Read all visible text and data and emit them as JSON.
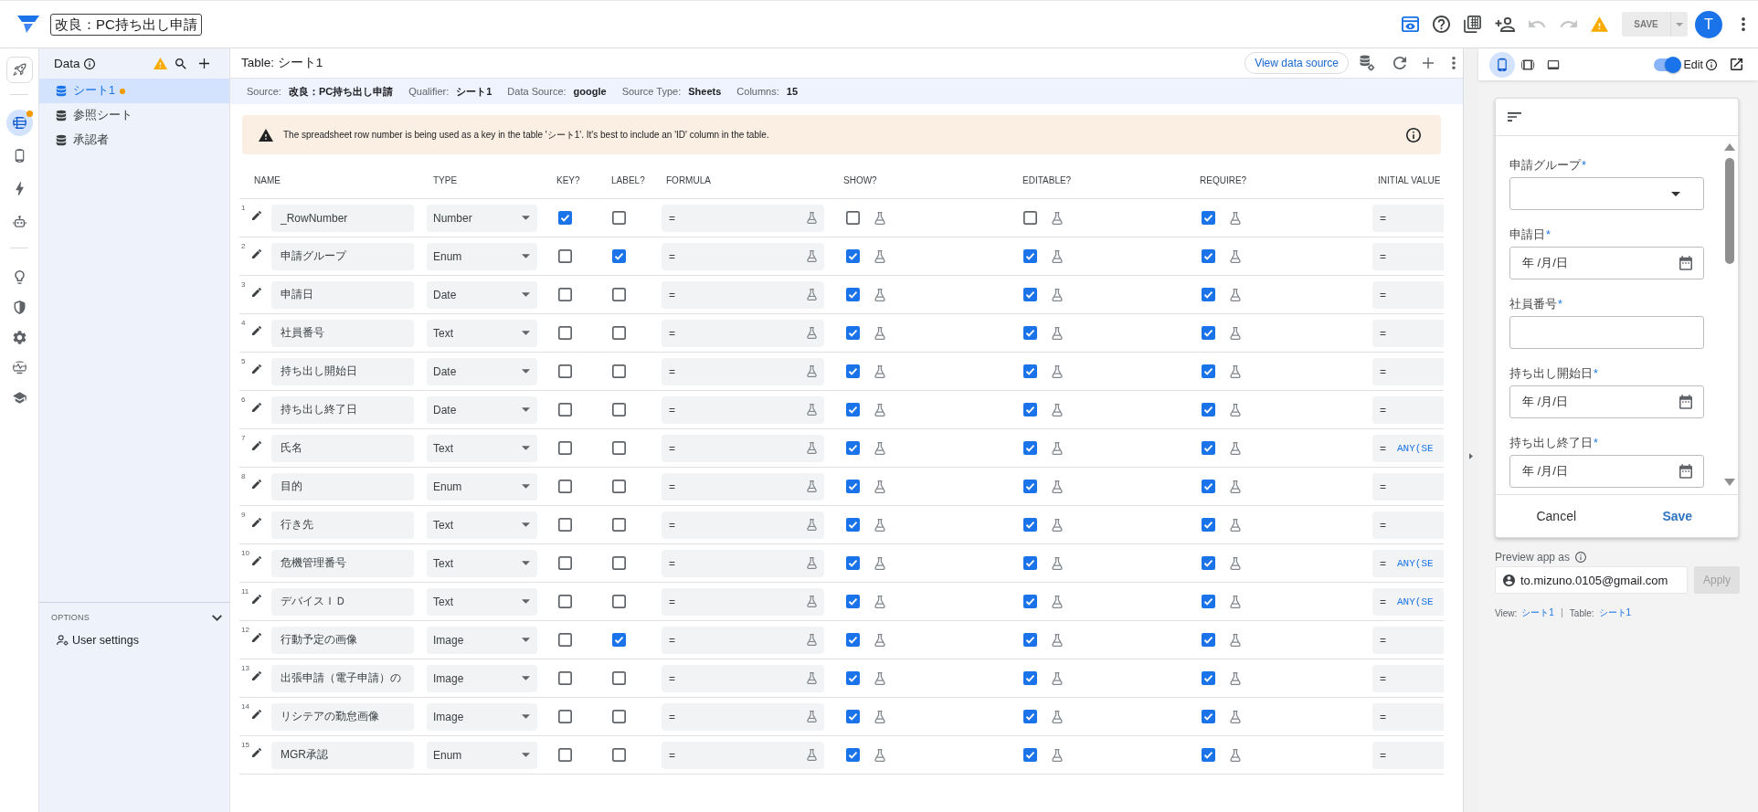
{
  "app_bar": {
    "title": "改良：PC持ち出し申請",
    "actions": [
      {
        "selected": true,
        "disabled": false
      },
      {
        "selected": false,
        "disabled": false
      },
      {
        "selected": false,
        "disabled": false
      },
      {
        "selected": false,
        "disabled": false
      },
      {
        "selected": false,
        "disabled": true
      },
      {
        "selected": false,
        "disabled": true
      },
      {
        "selected": false,
        "disabled": false
      }
    ],
    "save": {
      "label": "SAVE",
      "disabled": true
    },
    "avatar": "T"
  },
  "nav_rail": [
    [
      {
        "selected": false,
        "badge": false
      }
    ],
    [
      {
        "selected": true,
        "badge": true
      },
      {
        "selected": false,
        "badge": false
      },
      {
        "selected": false,
        "badge": false
      },
      {
        "selected": false,
        "badge": false
      }
    ],
    [
      {
        "selected": false,
        "badge": false
      },
      {
        "selected": false,
        "badge": false
      },
      {
        "selected": false,
        "badge": false
      },
      {
        "selected": false,
        "badge": false
      },
      {
        "selected": false,
        "badge": false
      }
    ]
  ],
  "data_panel": {
    "title": "Data",
    "tables": [
      {
        "name": "シート1",
        "selected": true,
        "modified": true
      },
      {
        "name": "参照シート",
        "selected": false,
        "modified": false
      },
      {
        "name": "承認者",
        "selected": false,
        "modified": false
      }
    ],
    "options": {
      "title": "OPTIONS",
      "expanded": true,
      "items": [
        "User settings"
      ]
    }
  },
  "table_editor": {
    "title": "Table: シート1",
    "view_source": "View data source",
    "source_info": [
      {
        "label": "Source:",
        "value": "改良：PC持ち出し申請"
      },
      {
        "label": "Qualifier:",
        "value": "シート1"
      },
      {
        "label": "Data Source:",
        "value": "google"
      },
      {
        "label": "Source Type:",
        "value": "Sheets"
      },
      {
        "label": "Columns:",
        "value": "15"
      }
    ],
    "warning": "The spreadsheet row number is being used as a key in the table 'シート1'. It's best to include an 'ID' column in the table.",
    "columns": [
      "NAME",
      "TYPE",
      "KEY?",
      "LABEL?",
      "FORMULA",
      "SHOW?",
      "EDITABLE?",
      "REQUIRE?",
      "INITIAL VALUE"
    ],
    "rows": [
      {
        "number": "1",
        "name": "_RowNumber",
        "type": "Number",
        "key": true,
        "label": false,
        "formula": "=",
        "show": false,
        "editable": false,
        "require": true,
        "initial": "="
      },
      {
        "number": "2",
        "name": "申請グループ",
        "type": "Enum",
        "key": false,
        "label": true,
        "formula": "=",
        "show": true,
        "editable": true,
        "require": true,
        "initial": "="
      },
      {
        "number": "3",
        "name": "申請日",
        "type": "Date",
        "key": false,
        "label": false,
        "formula": "=",
        "show": true,
        "editable": true,
        "require": true,
        "initial": "="
      },
      {
        "number": "4",
        "name": "社員番号",
        "type": "Text",
        "key": false,
        "label": false,
        "formula": "=",
        "show": true,
        "editable": true,
        "require": true,
        "initial": "="
      },
      {
        "number": "5",
        "name": "持ち出し開始日",
        "type": "Date",
        "key": false,
        "label": false,
        "formula": "=",
        "show": true,
        "editable": true,
        "require": true,
        "initial": "="
      },
      {
        "number": "6",
        "name": "持ち出し終了日",
        "type": "Date",
        "key": false,
        "label": false,
        "formula": "=",
        "show": true,
        "editable": true,
        "require": true,
        "initial": "="
      },
      {
        "number": "7",
        "name": "氏名",
        "type": "Text",
        "key": false,
        "label": false,
        "formula": "=",
        "show": true,
        "editable": true,
        "require": true,
        "initial": "=",
        "initial_expression": "ANY(SE"
      },
      {
        "number": "8",
        "name": "目的",
        "type": "Enum",
        "key": false,
        "label": false,
        "formula": "=",
        "show": true,
        "editable": true,
        "require": true,
        "initial": "="
      },
      {
        "number": "9",
        "name": "行き先",
        "type": "Text",
        "key": false,
        "label": false,
        "formula": "=",
        "show": true,
        "editable": true,
        "require": true,
        "initial": "="
      },
      {
        "number": "10",
        "name": "危機管理番号",
        "type": "Text",
        "key": false,
        "label": false,
        "formula": "=",
        "show": true,
        "editable": true,
        "require": true,
        "initial": "=",
        "initial_expression": "ANY(SE"
      },
      {
        "number": "11",
        "name": "デバイスＩＤ",
        "type": "Text",
        "key": false,
        "label": false,
        "formula": "=",
        "show": true,
        "editable": true,
        "require": true,
        "initial": "=",
        "initial_expression": "ANY(SE"
      },
      {
        "number": "12",
        "name": "行動予定の画像",
        "type": "Image",
        "key": false,
        "label": true,
        "formula": "=",
        "show": true,
        "editable": true,
        "require": true,
        "initial": "="
      },
      {
        "number": "13",
        "name": "出張申請（電子申請）の",
        "type": "Image",
        "key": false,
        "label": false,
        "formula": "=",
        "show": true,
        "editable": true,
        "require": true,
        "initial": "="
      },
      {
        "number": "14",
        "name": "リシテアの勤怠画像",
        "type": "Image",
        "key": false,
        "label": false,
        "formula": "=",
        "show": true,
        "editable": true,
        "require": true,
        "initial": "="
      },
      {
        "number": "15",
        "name": "MGR承認",
        "type": "Enum",
        "key": false,
        "label": false,
        "formula": "=",
        "show": true,
        "editable": true,
        "require": true,
        "initial": "="
      }
    ]
  },
  "preview_panel": {
    "devices": [
      {
        "selected": true
      },
      {
        "selected": false
      },
      {
        "selected": false
      }
    ],
    "edit": {
      "label": "Edit",
      "on": true
    },
    "form": {
      "fields": [
        {
          "kind": "dropdown",
          "label": "申請グループ",
          "required_mark": "*"
        },
        {
          "kind": "date",
          "label": "申請日",
          "required_mark": "*",
          "placeholder": "年 /月/日"
        },
        {
          "kind": "text",
          "label": "社員番号",
          "required_mark": "*"
        },
        {
          "kind": "date",
          "label": "持ち出し開始日",
          "required_mark": "*",
          "placeholder": "年 /月/日"
        },
        {
          "kind": "date",
          "label": "持ち出し終了日",
          "required_mark": "*",
          "placeholder": "年 /月/日"
        }
      ],
      "cancel": "Cancel",
      "save": "Save"
    },
    "preview_as": {
      "label": "Preview app as",
      "email": "to.mizuno.0105@gmail.com",
      "apply": {
        "label": "Apply",
        "disabled": true
      }
    },
    "context": [
      {
        "label": "View:",
        "value": "シート1"
      },
      {
        "label": "Table:",
        "value": "シート1"
      }
    ]
  }
}
